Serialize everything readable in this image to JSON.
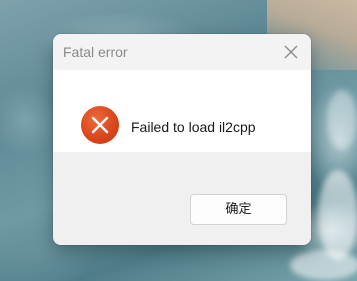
{
  "dialog": {
    "title": "Fatal error",
    "message": "Failed to load il2cpp",
    "ok_label": "确定",
    "close_icon": "close-icon",
    "status_icon": "error-icon",
    "accent_color": "#d8441b"
  }
}
